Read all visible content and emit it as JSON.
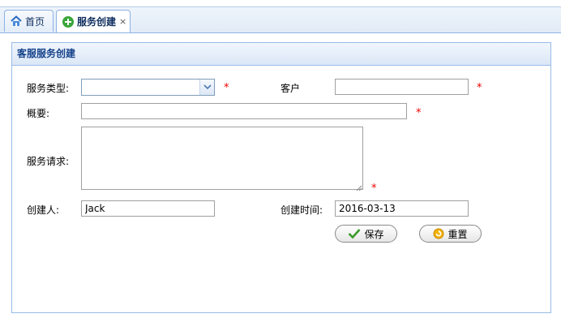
{
  "tabs": [
    {
      "label": "首页",
      "icon": "home-icon"
    },
    {
      "label": "服务创建",
      "icon": "add-circle-icon",
      "close": "×"
    }
  ],
  "panel": {
    "title": "客服服务创建"
  },
  "form": {
    "service_type": {
      "label": "服务类型:",
      "value": "",
      "required": "*"
    },
    "customer": {
      "label": "客户",
      "value": "",
      "required": "*"
    },
    "summary": {
      "label": "概要:",
      "value": "",
      "required": "*"
    },
    "service_request": {
      "label": "服务请求:",
      "value": "",
      "required": "*"
    },
    "creator": {
      "label": "创建人:",
      "value": "Jack"
    },
    "create_time": {
      "label": "创建时间:",
      "value": "2016-03-13"
    }
  },
  "buttons": {
    "save": "保存",
    "reset": "重置"
  },
  "colors": {
    "accent": "#15428b",
    "required": "#ee0000",
    "border": "#99bbe8"
  }
}
